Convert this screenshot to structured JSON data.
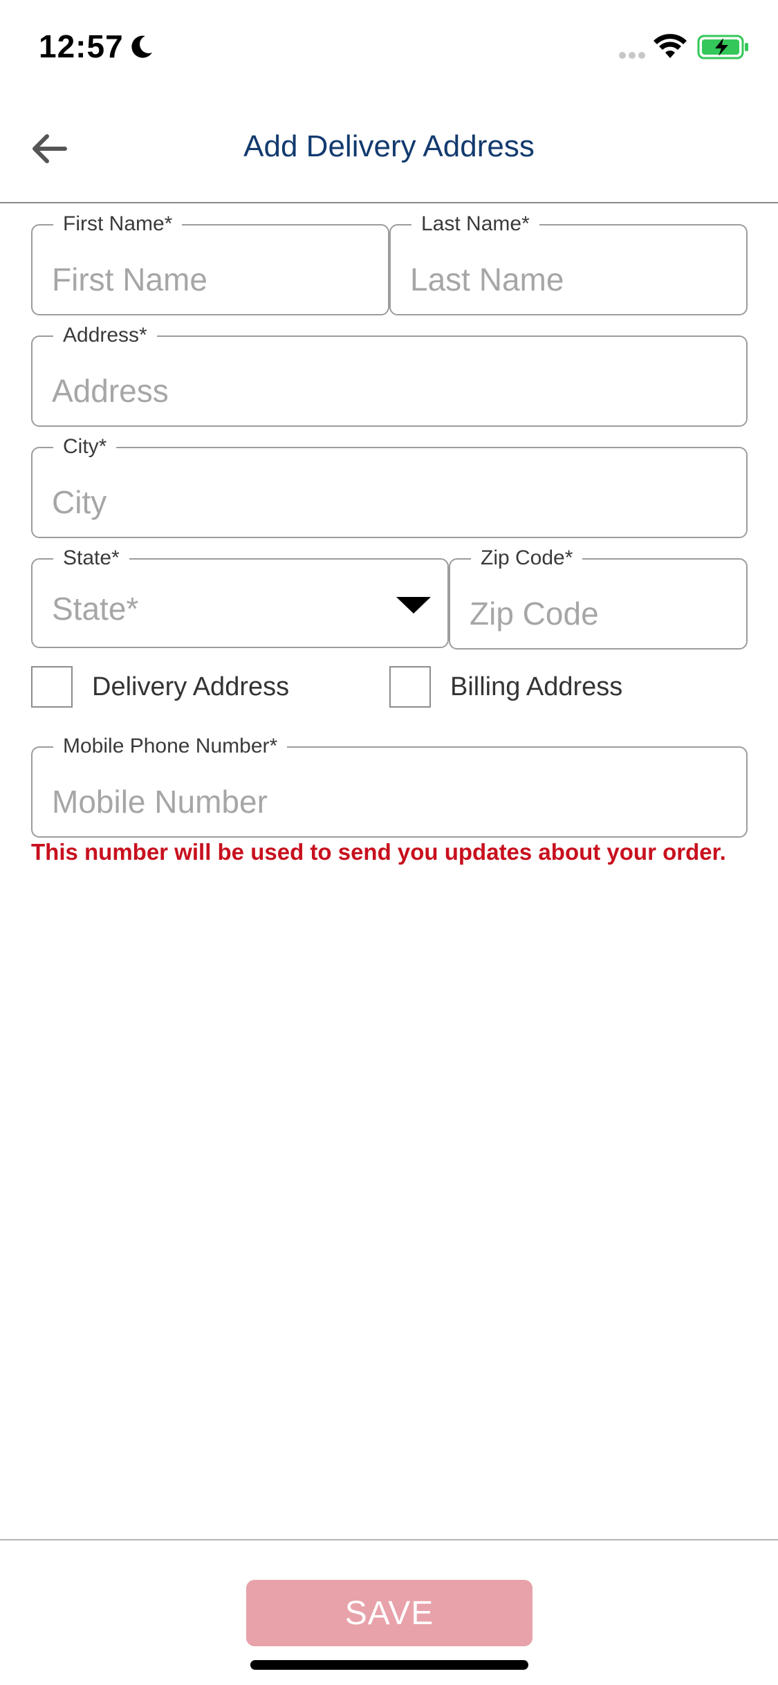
{
  "status_bar": {
    "time": "12:57",
    "moon_icon": "moon-icon",
    "wifi_icon": "wifi-icon",
    "battery_icon": "battery-charging-icon",
    "battery_color": "#34c759"
  },
  "header": {
    "title": "Add Delivery Address",
    "back_icon": "arrow-left-icon",
    "title_color": "#123a6e"
  },
  "form": {
    "first_name": {
      "label": "First Name*",
      "placeholder": "First Name",
      "value": ""
    },
    "last_name": {
      "label": "Last Name*",
      "placeholder": "Last Name",
      "value": ""
    },
    "address": {
      "label": "Address*",
      "placeholder": "Address",
      "value": ""
    },
    "city": {
      "label": "City*",
      "placeholder": "City",
      "value": ""
    },
    "state": {
      "label": "State*",
      "placeholder": "State*",
      "selected": ""
    },
    "zip": {
      "label": "Zip Code*",
      "placeholder": "Zip Code",
      "value": ""
    },
    "delivery_checkbox": {
      "label": "Delivery Address",
      "checked": false
    },
    "billing_checkbox": {
      "label": "Billing Address",
      "checked": false
    },
    "phone": {
      "label": "Mobile Phone Number*",
      "placeholder": "Mobile Number",
      "value": ""
    },
    "phone_note": "This number will be used to send you updates about your order.",
    "note_color": "#c8101e"
  },
  "footer": {
    "save_label": "SAVE",
    "save_color": "#e8a2aa"
  }
}
